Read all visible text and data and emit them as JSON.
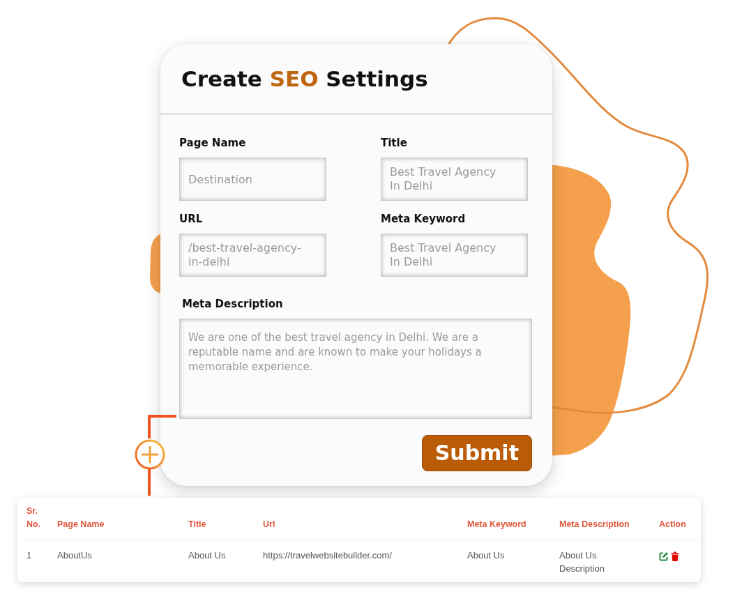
{
  "form": {
    "title": [
      {
        "text": "Create ",
        "highlighted": false
      },
      {
        "text": "SEO",
        "highlighted": true
      },
      {
        "text": " Settings",
        "highlighted": false
      }
    ],
    "fields": [
      {
        "label": "Page Name",
        "kind": "input",
        "placeholder": "Destination"
      },
      {
        "label": "Title",
        "kind": "textarea",
        "placeholder": "Best Travel Agency In Delhi"
      },
      {
        "label": "URL",
        "kind": "textarea",
        "placeholder": "/best-travel-agency-in-delhi"
      },
      {
        "label": "Meta Keyword",
        "kind": "textarea",
        "placeholder": "Best Travel Agency In Delhi"
      }
    ],
    "description": {
      "label": "Meta Description",
      "placeholder": "We are one of the best travel agency in Delhi. We are a reputable name and are known to make your holidays a memorable experience."
    },
    "submit": "Submit"
  },
  "table": {
    "columns": [
      "Sr. No.",
      "Page Name",
      "Title",
      "Url",
      "Meta Keyword",
      "Meta Description",
      "Action"
    ],
    "rows": [
      {
        "cells": [
          "1",
          "AboutUs",
          "About Us",
          "https://travelwebsitebuilder.com/",
          "About Us",
          "About Us Description"
        ]
      }
    ]
  }
}
